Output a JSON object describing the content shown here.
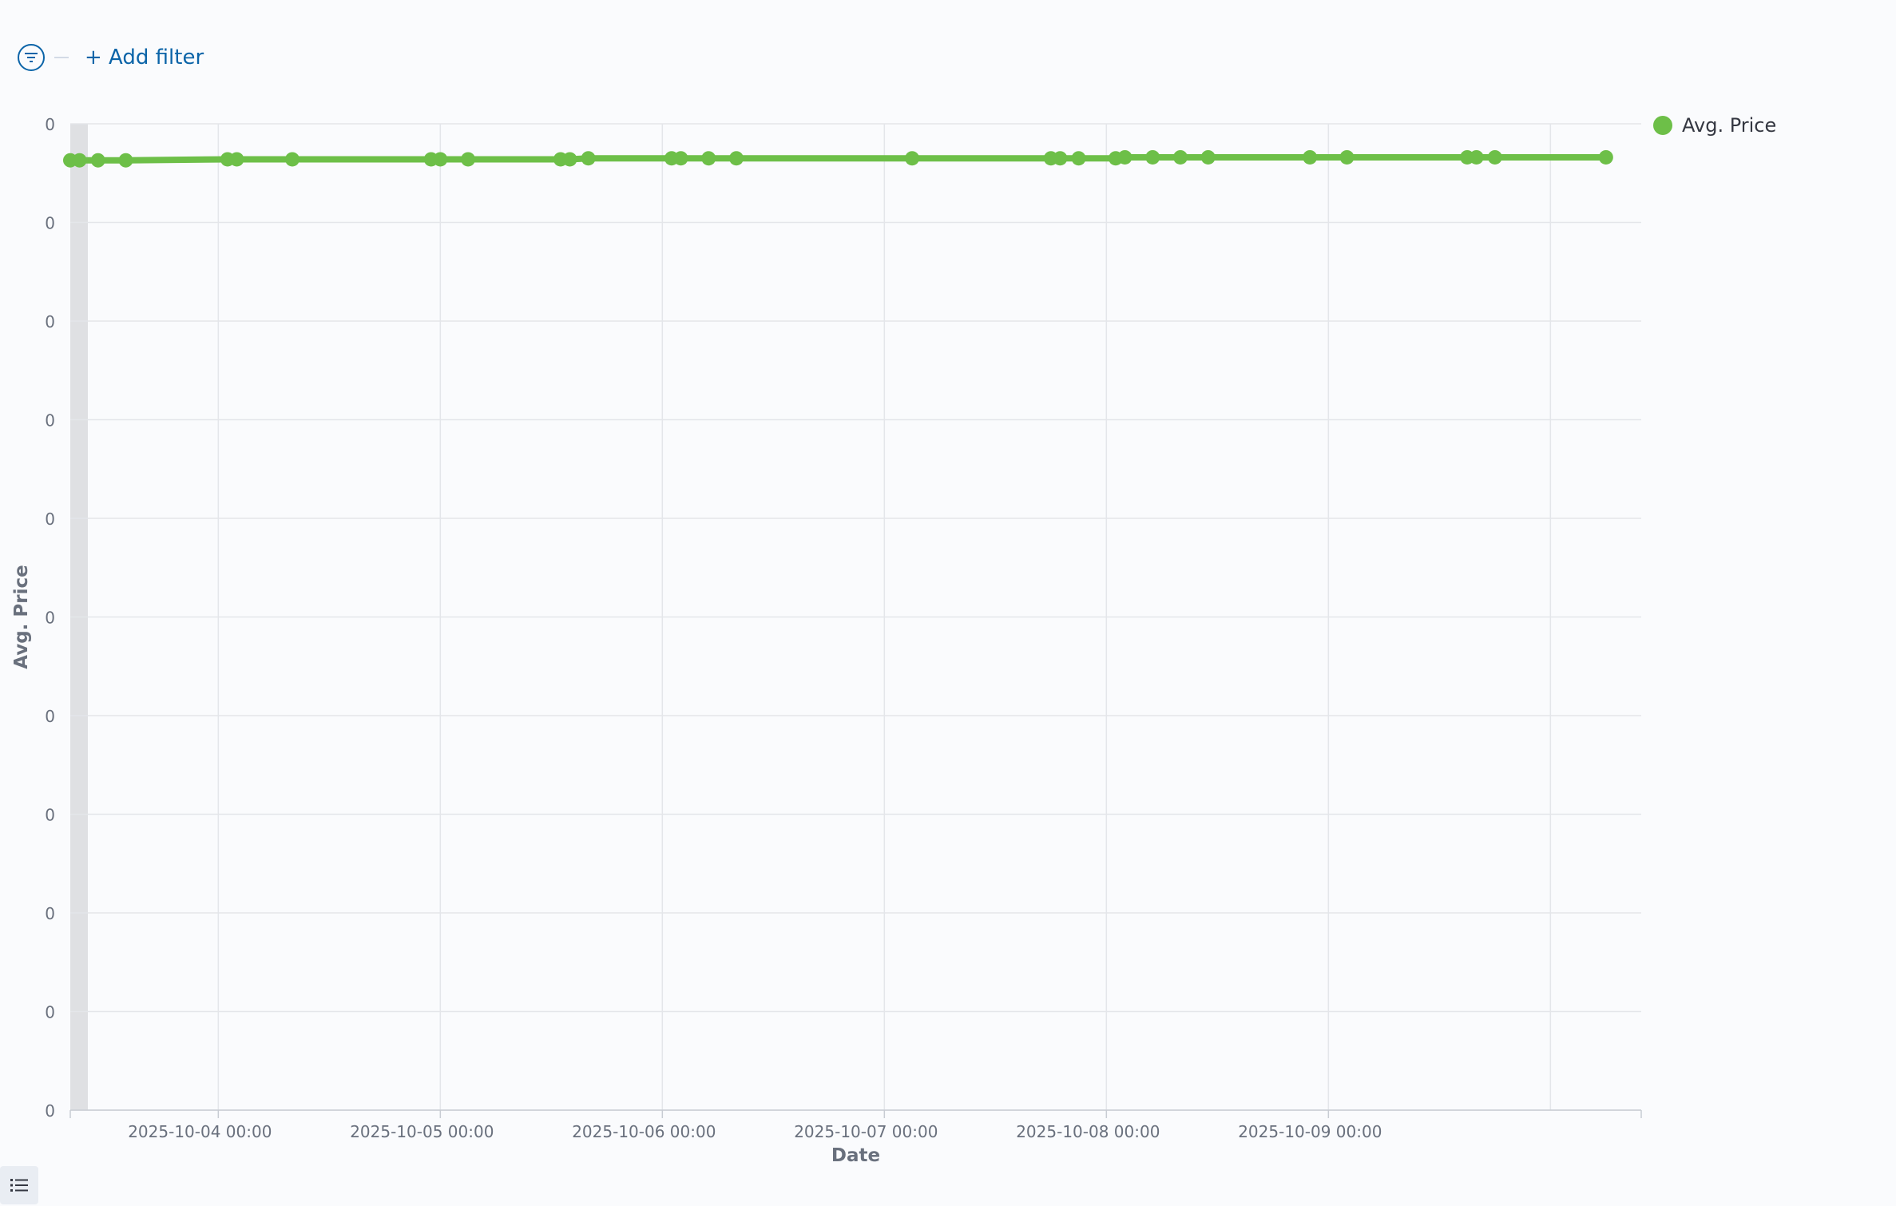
{
  "filter_bar": {
    "add_filter_label": "+ Add filter"
  },
  "icons": {
    "filter": "filter-icon",
    "legend_toggle": "list-icon"
  },
  "colors": {
    "series": "#6dbf48",
    "link": "#0b64a8"
  },
  "chart_data": {
    "type": "line",
    "ylabel": "Avg. Price",
    "xlabel": "Date",
    "y_tick_labels": [
      "0",
      "0",
      "0",
      "0",
      "0",
      "0",
      "0",
      "0",
      "0",
      "0",
      "0"
    ],
    "x_tick_labels": [
      "2025-10-04 00:00",
      "2025-10-05 00:00",
      "2025-10-06 00:00",
      "2025-10-07 00:00",
      "2025-10-08 00:00",
      "2025-10-09 00:00"
    ],
    "x_range": [
      "2025-10-03 08:00",
      "2025-10-10 06:00"
    ],
    "ylim": [
      0,
      1
    ],
    "grid": true,
    "legend_position": "top-right",
    "series": [
      {
        "name": "Avg. Price",
        "color": "#6dbf48",
        "x": [
          "2025-10-03 08:00",
          "2025-10-03 09:00",
          "2025-10-03 11:00",
          "2025-10-03 14:00",
          "2025-10-04 01:00",
          "2025-10-04 02:00",
          "2025-10-04 08:00",
          "2025-10-04 23:00",
          "2025-10-05 00:00",
          "2025-10-05 03:00",
          "2025-10-05 13:00",
          "2025-10-05 14:00",
          "2025-10-05 16:00",
          "2025-10-06 01:00",
          "2025-10-06 02:00",
          "2025-10-06 05:00",
          "2025-10-06 08:00",
          "2025-10-07 03:00",
          "2025-10-07 18:00",
          "2025-10-07 19:00",
          "2025-10-07 21:00",
          "2025-10-08 01:00",
          "2025-10-08 02:00",
          "2025-10-08 05:00",
          "2025-10-08 08:00",
          "2025-10-08 11:00",
          "2025-10-08 22:00",
          "2025-10-09 02:00",
          "2025-10-09 15:00",
          "2025-10-09 16:00",
          "2025-10-09 18:00",
          "2025-10-10 06:00"
        ],
        "values": [
          0.963,
          0.963,
          0.963,
          0.963,
          0.964,
          0.964,
          0.964,
          0.964,
          0.964,
          0.964,
          0.964,
          0.964,
          0.965,
          0.965,
          0.965,
          0.965,
          0.965,
          0.965,
          0.965,
          0.965,
          0.965,
          0.965,
          0.966,
          0.966,
          0.966,
          0.966,
          0.966,
          0.966,
          0.966,
          0.966,
          0.966,
          0.966
        ]
      }
    ]
  }
}
